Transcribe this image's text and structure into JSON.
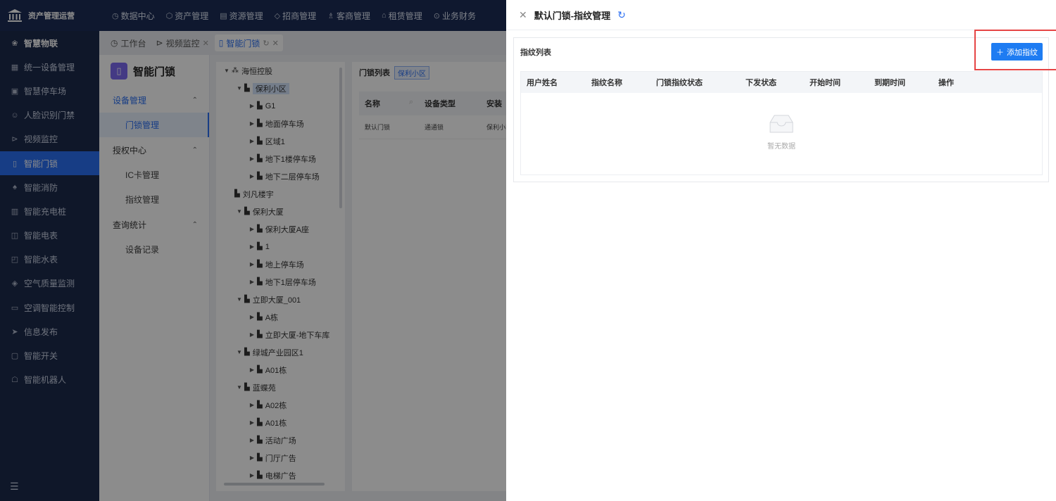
{
  "app": {
    "brand": "资产管理运营"
  },
  "topnav": [
    {
      "label": "数据中心",
      "icon": "dashboard-icon"
    },
    {
      "label": "资产管理",
      "icon": "cube-icon"
    },
    {
      "label": "资源管理",
      "icon": "document-icon"
    },
    {
      "label": "招商管理",
      "icon": "diamond-icon"
    },
    {
      "label": "客商管理",
      "icon": "users-icon"
    },
    {
      "label": "租赁管理",
      "icon": "home-icon"
    },
    {
      "label": "业务财务",
      "icon": "coin-icon"
    }
  ],
  "sidebar": {
    "items": [
      {
        "label": "智慧物联",
        "icon": "iot-icon"
      },
      {
        "label": "统一设备管理",
        "icon": "grid-icon"
      },
      {
        "label": "智慧停车场",
        "icon": "parking-icon"
      },
      {
        "label": "人脸识别门禁",
        "icon": "face-icon"
      },
      {
        "label": "视频监控",
        "icon": "camera-icon"
      },
      {
        "label": "智能门锁",
        "icon": "lock-icon"
      },
      {
        "label": "智能消防",
        "icon": "fire-icon"
      },
      {
        "label": "智能充电桩",
        "icon": "charger-icon"
      },
      {
        "label": "智能电表",
        "icon": "meter-icon"
      },
      {
        "label": "智能水表",
        "icon": "water-meter-icon"
      },
      {
        "label": "空气质量监测",
        "icon": "air-icon"
      },
      {
        "label": "空调智能控制",
        "icon": "ac-icon"
      },
      {
        "label": "信息发布",
        "icon": "send-icon"
      },
      {
        "label": "智能开关",
        "icon": "switch-icon"
      },
      {
        "label": "智能机器人",
        "icon": "robot-icon"
      }
    ]
  },
  "tabs": [
    {
      "label": "工作台",
      "icon": "clock-icon"
    },
    {
      "label": "视频监控",
      "icon": "camera-icon"
    },
    {
      "label": "智能门锁",
      "icon": "lock-icon"
    }
  ],
  "subnav": {
    "title": "智能门锁",
    "groups": [
      {
        "label": "设备管理",
        "items": [
          "门锁管理"
        ]
      },
      {
        "label": "授权中心",
        "items": [
          "IC卡管理",
          "指纹管理"
        ]
      },
      {
        "label": "查询统计",
        "items": [
          "设备记录"
        ]
      }
    ]
  },
  "tree": [
    {
      "label": "海恒控股",
      "level": 0,
      "expanded": true,
      "root": true
    },
    {
      "label": "保利小区",
      "level": 1,
      "expanded": true,
      "selected": true
    },
    {
      "label": "G1",
      "level": 2
    },
    {
      "label": "地面停车场",
      "level": 2
    },
    {
      "label": "区域1",
      "level": 2
    },
    {
      "label": "地下1楼停车场",
      "level": 2
    },
    {
      "label": "地下二层停车场",
      "level": 2
    },
    {
      "label": "刘凡楼宇",
      "level": 1,
      "leaf": true
    },
    {
      "label": "保利大厦",
      "level": 1,
      "expanded": true
    },
    {
      "label": "保利大厦A座",
      "level": 2
    },
    {
      "label": "1",
      "level": 2
    },
    {
      "label": "地上停车场",
      "level": 2
    },
    {
      "label": "地下1层停车场",
      "level": 2
    },
    {
      "label": "立即大厦_001",
      "level": 1,
      "expanded": true
    },
    {
      "label": "A栋",
      "level": 2
    },
    {
      "label": "立即大厦-地下车库",
      "level": 2
    },
    {
      "label": "绿城产业园区1",
      "level": 1,
      "expanded": true
    },
    {
      "label": "A01栋",
      "level": 2
    },
    {
      "label": "蓝蝶苑",
      "level": 1,
      "expanded": true
    },
    {
      "label": "A02栋",
      "level": 2
    },
    {
      "label": "A01栋",
      "level": 2
    },
    {
      "label": "活动广场",
      "level": 2
    },
    {
      "label": "门厅广告",
      "level": 2
    },
    {
      "label": "电梯广告",
      "level": 2
    }
  ],
  "locklist": {
    "title": "门锁列表",
    "location_tag": "保利小区",
    "columns": [
      "名称",
      "设备类型",
      "安装"
    ],
    "rows": [
      [
        "默认门锁",
        "通通锁",
        "保利小区"
      ]
    ]
  },
  "drawer": {
    "title": "默认门锁-指纹管理",
    "panel_title": "指纹列表",
    "add_button": "添加指纹",
    "columns": [
      "用户姓名",
      "指纹名称",
      "门锁指纹状态",
      "下发状态",
      "开始时间",
      "到期时间",
      "操作"
    ],
    "empty_text": "暂无数据"
  },
  "colors": {
    "topbar": "#1d2d56",
    "sidebar": "#1d2a4b",
    "accent": "#2b6ff2",
    "add_button": "#1e7cf2",
    "highlight": "#e64545"
  }
}
